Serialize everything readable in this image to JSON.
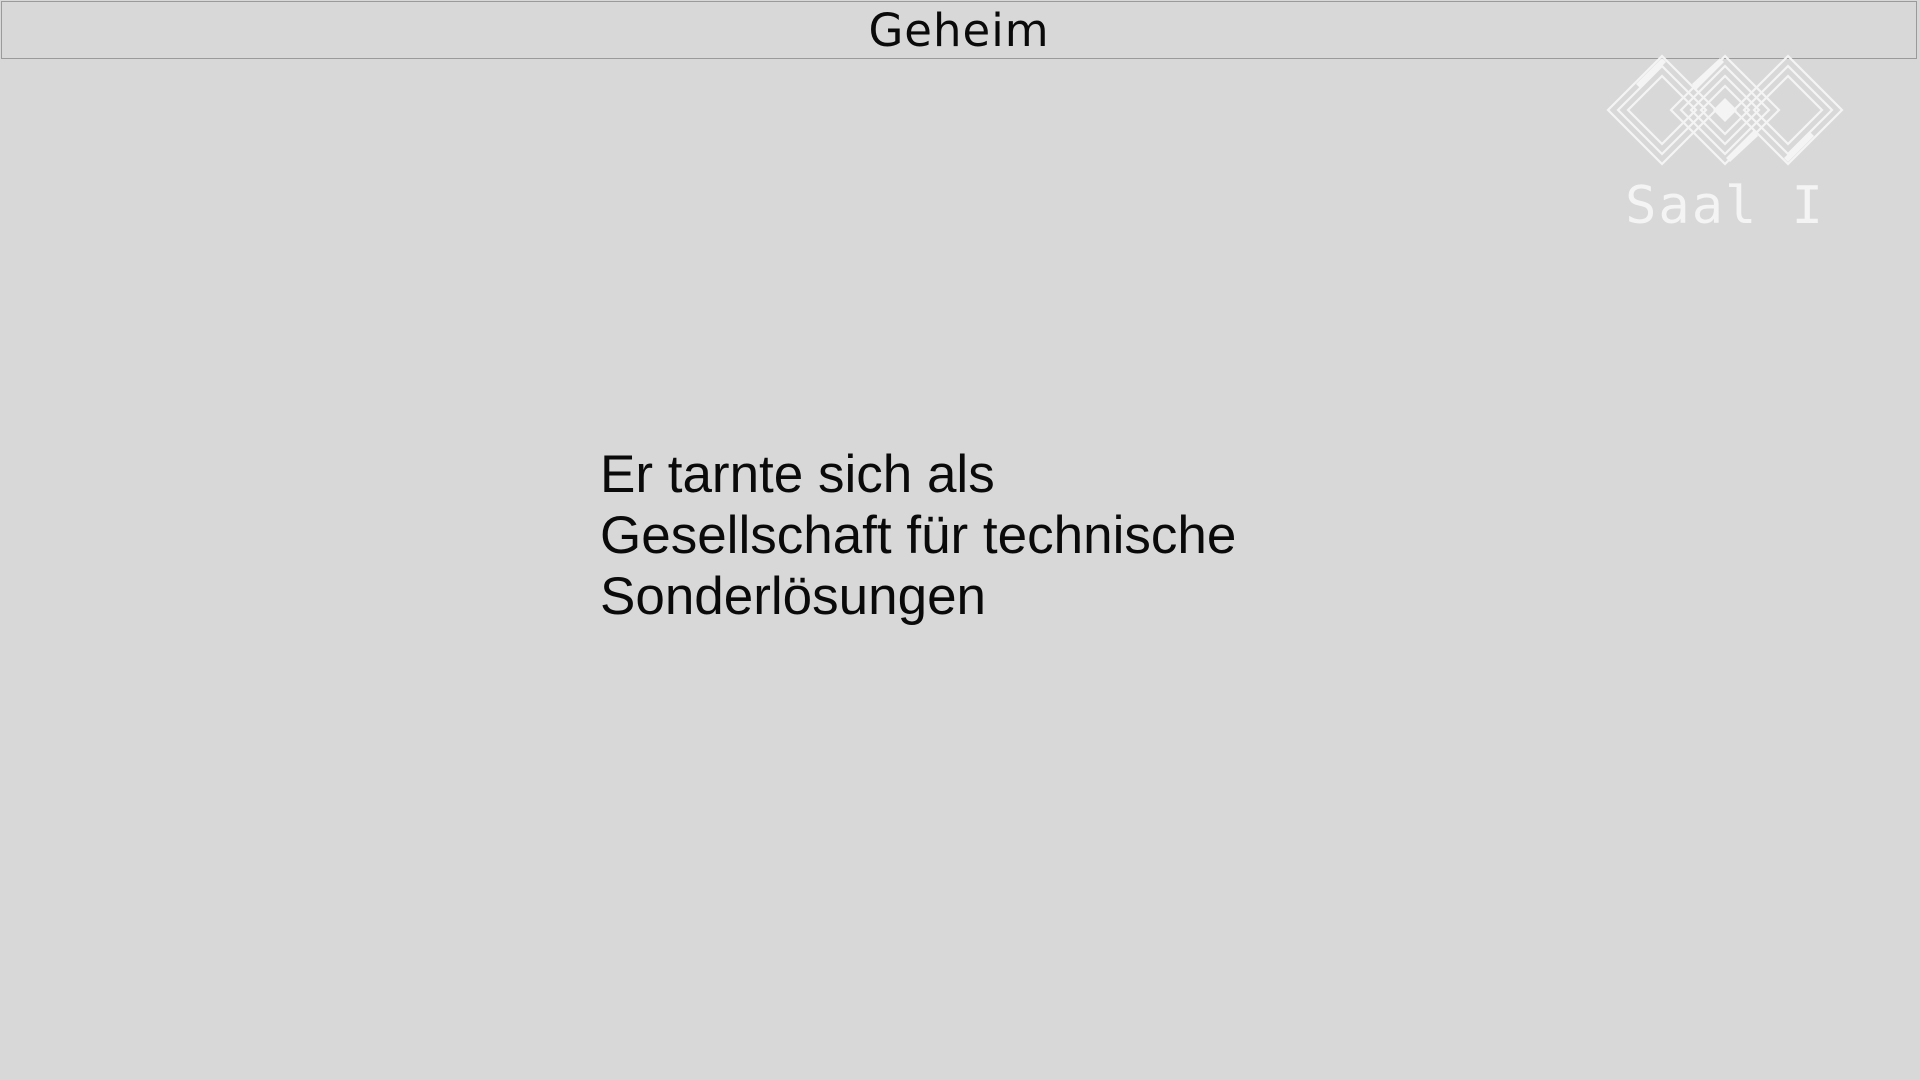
{
  "header": {
    "title": "Geheim"
  },
  "logo": {
    "label": "Saal I",
    "icon": "interlocking-diamond-logo-icon",
    "color": "#f4f4f4"
  },
  "message": {
    "lines": [
      "Er tarnte sich als",
      "Gesellschaft für technische",
      "Sonderlösungen"
    ]
  },
  "colors": {
    "background": "#d8d8d8",
    "text": "#0a0a0a",
    "border": "#9a9a9a"
  }
}
